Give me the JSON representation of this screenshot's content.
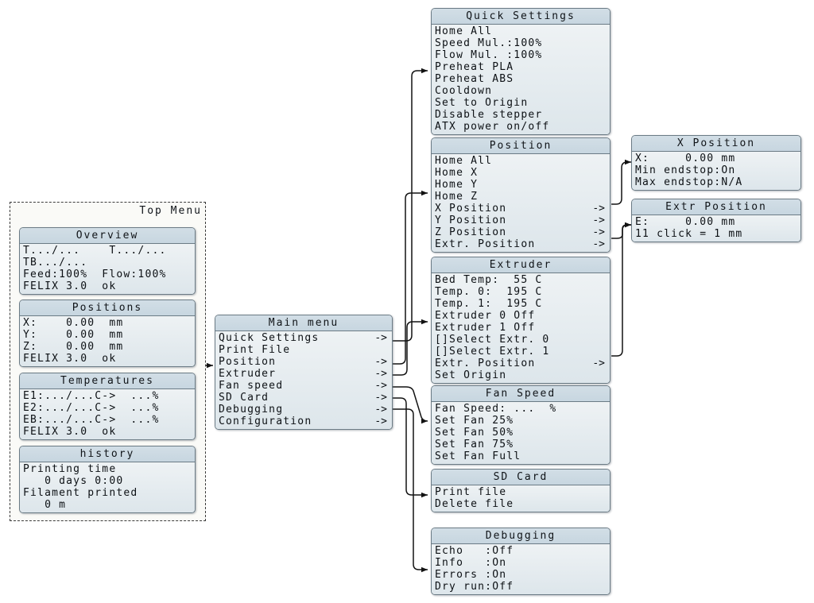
{
  "diagram": {
    "title": "FELIX 3.0 printer LCD menu tree",
    "colors": {
      "panel_border": "#6b7b85",
      "panel_body": "#e9eef1",
      "panel_title": "#cfdce5",
      "wire": "#1a1a1a",
      "group_bg": "#fafaf7"
    }
  },
  "group": {
    "label": "Top Menu"
  },
  "panels": {
    "overview": {
      "title": "Overview",
      "rows": [
        {
          "text": "T...&#47;...    T...&#47;...",
          "arrow": ""
        },
        {
          "text": "TB...&#47;...",
          "arrow": ""
        },
        {
          "text": "Feed:100%  Flow:100%",
          "arrow": ""
        },
        {
          "text": "FELIX 3.0  ok",
          "arrow": ""
        }
      ]
    },
    "positions": {
      "title": "Positions",
      "rows": [
        {
          "text": "X:    0.00  mm",
          "arrow": ""
        },
        {
          "text": "Y:    0.00  mm",
          "arrow": ""
        },
        {
          "text": "Z:    0.00  mm",
          "arrow": ""
        },
        {
          "text": "FELIX 3.0  ok",
          "arrow": ""
        }
      ]
    },
    "temperatures": {
      "title": "Temperatures",
      "rows": [
        {
          "text": "E1:...&#47;...C-&gt;  ...%",
          "arrow": ""
        },
        {
          "text": "E2:...&#47;...C-&gt;  ...%",
          "arrow": ""
        },
        {
          "text": "EB:...&#47;...C-&gt;  ...%",
          "arrow": ""
        },
        {
          "text": "FELIX 3.0  ok",
          "arrow": ""
        }
      ]
    },
    "history": {
      "title": "history",
      "rows": [
        {
          "text": "Printing time",
          "arrow": ""
        },
        {
          "text": "   0 days 0:00",
          "arrow": ""
        },
        {
          "text": "Filament printed",
          "arrow": ""
        },
        {
          "text": "   0 m",
          "arrow": ""
        }
      ]
    },
    "main_menu": {
      "title": "Main menu",
      "rows": [
        {
          "text": "Quick Settings",
          "arrow": "-&gt;"
        },
        {
          "text": "Print File",
          "arrow": ""
        },
        {
          "text": "Position",
          "arrow": "-&gt;"
        },
        {
          "text": "Extruder",
          "arrow": "-&gt;"
        },
        {
          "text": "Fan speed",
          "arrow": "-&gt;"
        },
        {
          "text": "SD Card",
          "arrow": "-&gt;"
        },
        {
          "text": "Debugging",
          "arrow": "-&gt;"
        },
        {
          "text": "Configuration",
          "arrow": "-&gt;"
        }
      ]
    },
    "quick_settings": {
      "title": "Quick Settings",
      "rows": [
        {
          "text": "Home All",
          "arrow": ""
        },
        {
          "text": "Speed Mul.:100%",
          "arrow": ""
        },
        {
          "text": "Flow Mul. :100%",
          "arrow": ""
        },
        {
          "text": "Preheat PLA",
          "arrow": ""
        },
        {
          "text": "Preheat ABS",
          "arrow": ""
        },
        {
          "text": "Cooldown",
          "arrow": ""
        },
        {
          "text": "Set to Origin",
          "arrow": ""
        },
        {
          "text": "Disable stepper",
          "arrow": ""
        },
        {
          "text": "ATX power on&#47;off",
          "arrow": ""
        }
      ]
    },
    "position": {
      "title": "Position",
      "rows": [
        {
          "text": "Home All",
          "arrow": ""
        },
        {
          "text": "Home X",
          "arrow": ""
        },
        {
          "text": "Home Y",
          "arrow": ""
        },
        {
          "text": "Home Z",
          "arrow": ""
        },
        {
          "text": "X Position",
          "arrow": "-&gt;"
        },
        {
          "text": "Y Position",
          "arrow": "-&gt;"
        },
        {
          "text": "Z Position",
          "arrow": "-&gt;"
        },
        {
          "text": "Extr. Position",
          "arrow": "-&gt;"
        }
      ]
    },
    "extruder": {
      "title": "Extruder",
      "rows": [
        {
          "text": "Bed Temp:  55 C",
          "arrow": ""
        },
        {
          "text": "Temp. 0:  195 C",
          "arrow": ""
        },
        {
          "text": "Temp. 1:  195 C",
          "arrow": ""
        },
        {
          "text": "Extruder 0 Off",
          "arrow": ""
        },
        {
          "text": "Extruder 1 Off",
          "arrow": ""
        },
        {
          "text": "[]Select Extr. 0",
          "arrow": ""
        },
        {
          "text": "[]Select Extr. 1",
          "arrow": ""
        },
        {
          "text": "Extr. Position",
          "arrow": "-&gt;"
        },
        {
          "text": "Set Origin",
          "arrow": ""
        }
      ]
    },
    "fan_speed": {
      "title": "Fan Speed",
      "rows": [
        {
          "text": "Fan Speed: ...  %",
          "arrow": ""
        },
        {
          "text": "Set Fan 25%",
          "arrow": ""
        },
        {
          "text": "Set Fan 50%",
          "arrow": ""
        },
        {
          "text": "Set Fan 75%",
          "arrow": ""
        },
        {
          "text": "Set Fan Full",
          "arrow": ""
        }
      ]
    },
    "sd_card": {
      "title": "SD Card",
      "rows": [
        {
          "text": "Print file",
          "arrow": ""
        },
        {
          "text": "Delete file",
          "arrow": ""
        }
      ]
    },
    "debugging": {
      "title": "Debugging",
      "rows": [
        {
          "text": "Echo   :Off",
          "arrow": ""
        },
        {
          "text": "Info   :On",
          "arrow": ""
        },
        {
          "text": "Errors :On",
          "arrow": ""
        },
        {
          "text": "Dry run:Off",
          "arrow": ""
        }
      ]
    },
    "x_position": {
      "title": "X Position",
      "rows": [
        {
          "text": "X:     0.00 mm",
          "arrow": ""
        },
        {
          "text": "Min endstop:On",
          "arrow": ""
        },
        {
          "text": "Max endstop:N&#47;A",
          "arrow": ""
        }
      ]
    },
    "extr_position": {
      "title": "Extr Position",
      "rows": [
        {
          "text": "E:     0.00 mm",
          "arrow": ""
        },
        {
          "text": "11 click = 1 mm",
          "arrow": ""
        }
      ]
    }
  }
}
